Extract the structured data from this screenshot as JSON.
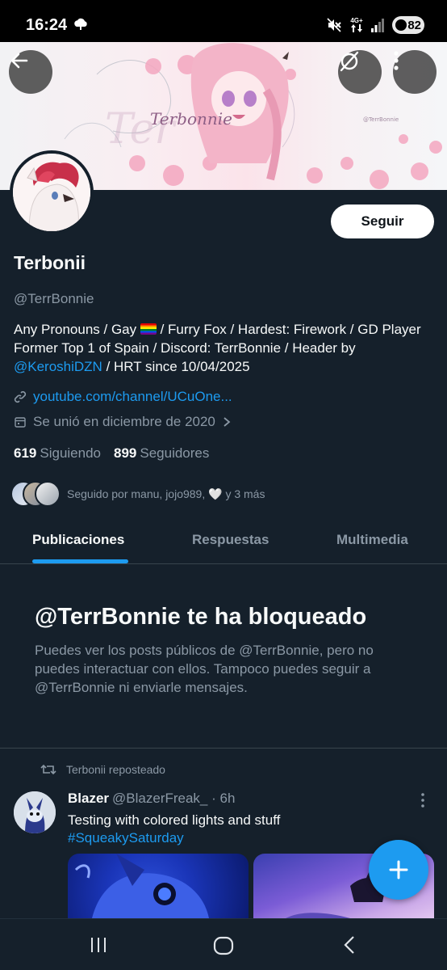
{
  "status_bar": {
    "time": "16:24",
    "network_label": "4G+",
    "battery": "82",
    "icons": [
      "cloud-icon",
      "mute-icon",
      "network-icon",
      "signal-icon",
      "battery-icon"
    ]
  },
  "header": {
    "banner_text": "Terbonnie",
    "banner_small_text": "@TerrBonnie",
    "back_icon": "arrow-left-icon",
    "grok_icon": "slash-circle-icon",
    "more_icon": "more-vertical-icon"
  },
  "profile": {
    "follow_label": "Seguir",
    "name": "Terbonii",
    "handle": "@TerrBonnie",
    "bio_part1": "Any Pronouns / Gay ",
    "bio_part2": " / Furry Fox / Hardest: Firework / GD Player Former Top 1 of Spain / Discord: TerrBonnie / Header by ",
    "bio_link": "@KeroshiDZN",
    "bio_part3": " / HRT since 10/04/2025",
    "url": "youtube.com/channel/UCuOne...",
    "joined": "Se unió en diciembre de 2020",
    "following_count": "619",
    "following_label": "Siguiendo",
    "followers_count": "899",
    "followers_label": "Seguidores",
    "followed_by": "Seguido por manu, jojo989, 🤍 y 3 más"
  },
  "tabs": [
    {
      "label": "Publicaciones",
      "active": true
    },
    {
      "label": "Respuestas",
      "active": false
    },
    {
      "label": "Multimedia",
      "active": false
    }
  ],
  "blocked": {
    "title": "@TerrBonnie te ha bloqueado",
    "body": "Puedes ver los posts públicos de @TerrBonnie, pero no puedes interactuar con ellos. Tampoco puedes seguir a @TerrBonnie ni enviarle mensajes."
  },
  "tweet": {
    "repost_label": "Terbonii reposteado",
    "author_name": "Blazer",
    "author_handle": "@BlazerFreak_",
    "time": "· 6h",
    "text": "Testing with colored lights and stuff",
    "hashtag": "#SqueakySaturday"
  },
  "colors": {
    "background": "#15202b",
    "accent": "#1d9bf0",
    "secondary_text": "#8b98a5"
  }
}
